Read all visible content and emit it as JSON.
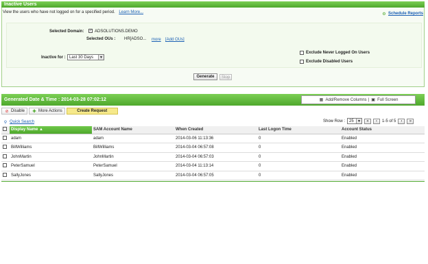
{
  "header": {
    "title": "Inactive Users",
    "description": "View the users who have not logged on for a specified period.",
    "learn_more": "Learn More...",
    "schedule_reports": "Schedule Reports"
  },
  "form": {
    "domain_label": "Selected Domain:",
    "domain_value": "ADSOLUTIONS.DEMO",
    "ous_label": "Selected OUs :",
    "ous_value": "HR[ADSO...",
    "more_link": "more",
    "add_ous_link": "[Add OUs]",
    "inactive_label": "Inactive for :",
    "inactive_value": "Last 30 Days",
    "exclude_never_label": "Exclude Never Logged On Users",
    "exclude_disabled_label": "Exclude Disabled Users",
    "generate_label": "Generate",
    "stop_label": "Stop"
  },
  "results": {
    "generated_label": "Generated Date & Time : 2014-03-28 07:02:12",
    "add_remove_columns": "Add/Remove Columns",
    "separator": "|",
    "full_screen": "Full Screen",
    "disable_label": "Disable",
    "more_actions_label": "More Actions",
    "create_request_label": "Create Request",
    "quick_search": "Quick Search",
    "show_row_label": "Show Row :",
    "show_row_value": "25",
    "page_range": "1-5 of 5",
    "columns": [
      "Display Name",
      "SAM Account Name",
      "When Created",
      "Last Logon Time",
      "Account Status"
    ],
    "rows": [
      [
        "adam",
        "adam",
        "2014-03-06 11:13:36",
        "0",
        "Enabled"
      ],
      [
        "BillWilliams",
        "BillWilliams",
        "2014-03-04 06:57:08",
        "0",
        "Enabled"
      ],
      [
        "JohnMartin",
        "JohnMartin",
        "2014-03-04 06:57:03",
        "0",
        "Enabled"
      ],
      [
        "PeterSamuel",
        "PeterSamuel",
        "2014-03-04 11:13:14",
        "0",
        "Enabled"
      ],
      [
        "SallyJones",
        "SallyJones",
        "2014-03-04 06:57:05",
        "0",
        "Enabled"
      ]
    ]
  },
  "colors": {
    "accent_green": "#4ea82c",
    "link_blue": "#1a5fb4",
    "create_request_bg": "#f6e98a"
  }
}
